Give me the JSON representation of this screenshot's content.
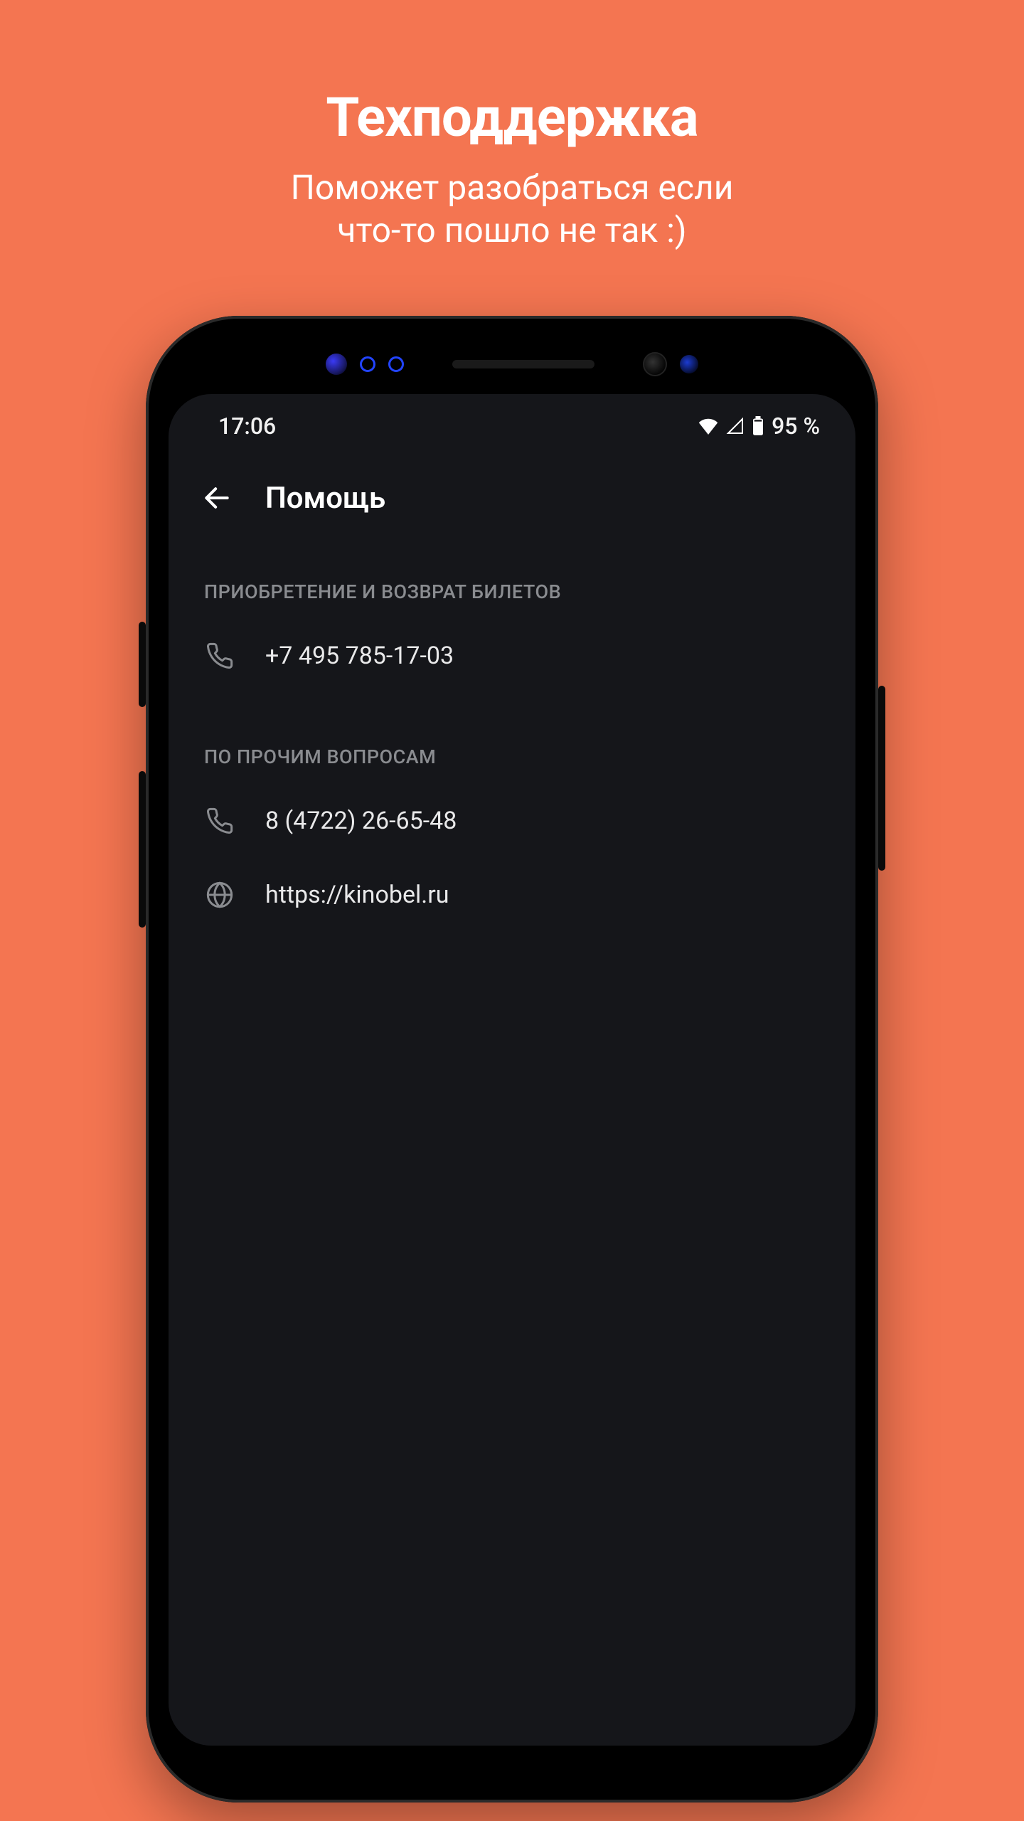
{
  "promo": {
    "title": "Техподдержка",
    "subtitle_line1": "Поможет разобраться если",
    "subtitle_line2": "что-то пошло не так :)"
  },
  "statusbar": {
    "time": "17:06",
    "battery_text": "95 %"
  },
  "appbar": {
    "title": "Помощь"
  },
  "help": {
    "section1_label": "ПРИОБРЕТЕНИЕ И ВОЗВРАТ БИЛЕТОВ",
    "phone1": "+7 495 785-17-03",
    "section2_label": "ПО ПРОЧИМ ВОПРОСАМ",
    "phone2": "8 (4722) 26-65-48",
    "website": "https://kinobel.ru"
  }
}
